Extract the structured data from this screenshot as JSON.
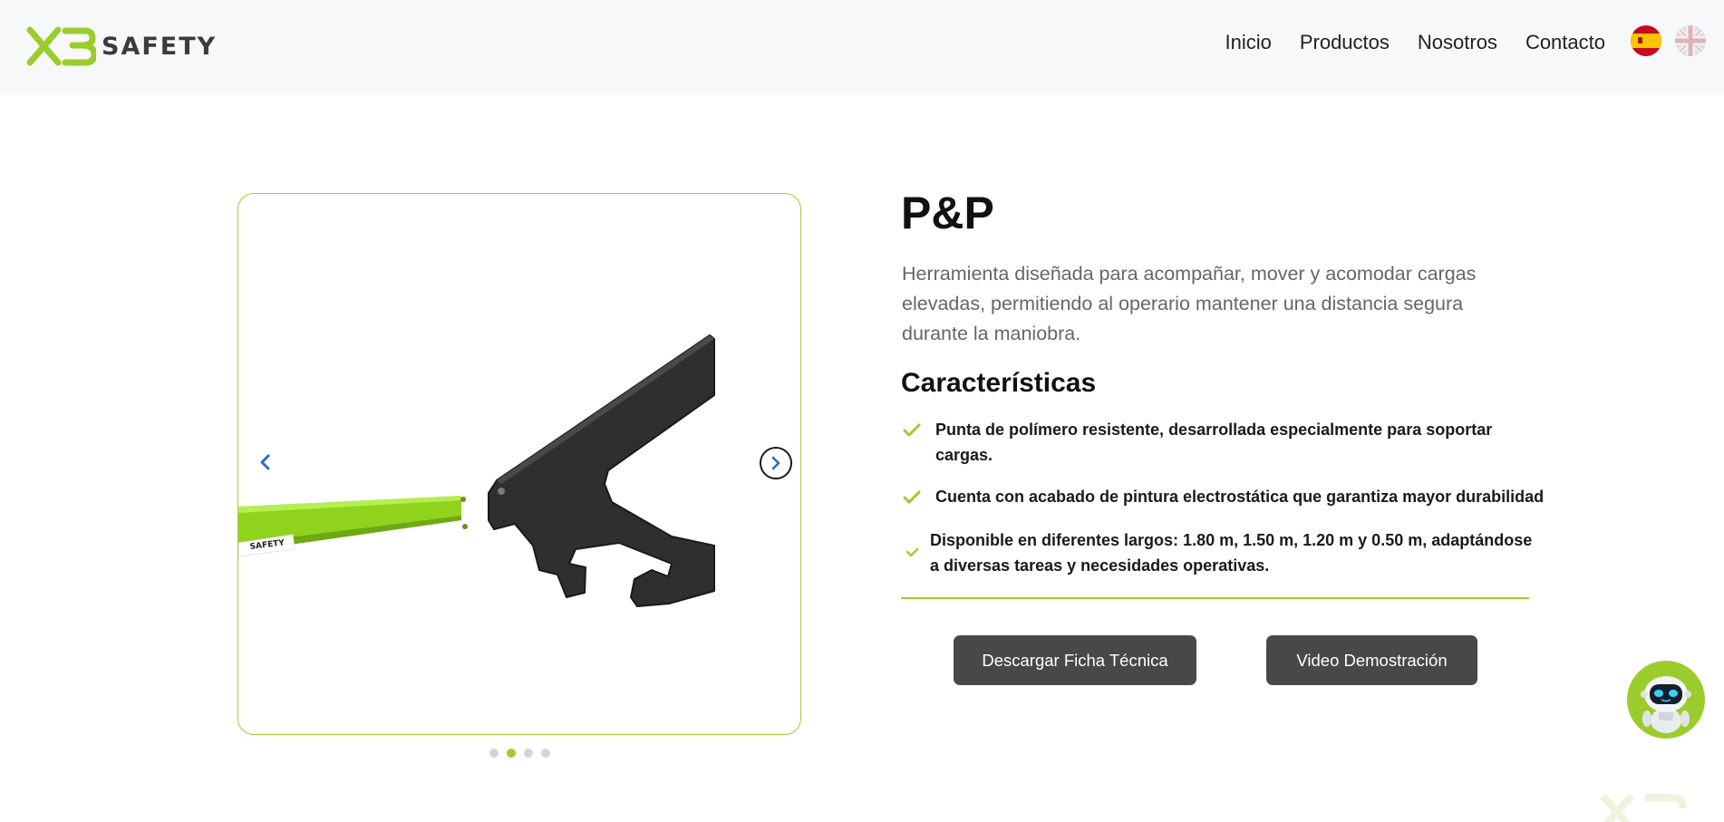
{
  "header": {
    "logo_mark": "X3",
    "logo_text": "SAFETY",
    "nav": [
      "Inicio",
      "Productos",
      "Nosotros",
      "Contacto"
    ],
    "languages": [
      "es-flag-icon",
      "uk-flag-icon"
    ]
  },
  "carousel": {
    "prev_icon": "chevron-left-icon",
    "next_icon": "chevron-right-icon",
    "slide_count": 4,
    "active_slide": 2,
    "product_brand_label": "SAFETY"
  },
  "product": {
    "title": "P&P",
    "description": "Herramienta diseñada para acompañar, mover y acomodar cargas elevadas, permitiendo al operario mantener una distancia segura durante la maniobra.",
    "features_heading": "Características",
    "features": [
      "Punta de polímero resistente, desarrollada especialmente para soportar cargas.",
      "Cuenta con acabado de pintura electrostática que garantiza mayor durabilidad",
      "Disponible en diferentes largos: 1.80 m, 1.50 m, 1.20 m y 0.50 m, adaptándose a diversas tareas y necesidades operativas."
    ]
  },
  "actions": {
    "download_label": "Descargar Ficha Técnica",
    "video_label": "Video Demostración"
  },
  "chatbot": {
    "icon": "robot-icon"
  },
  "colors": {
    "accent": "#9ccc2b",
    "button": "#484848",
    "header_bg": "#f6f8f9"
  }
}
